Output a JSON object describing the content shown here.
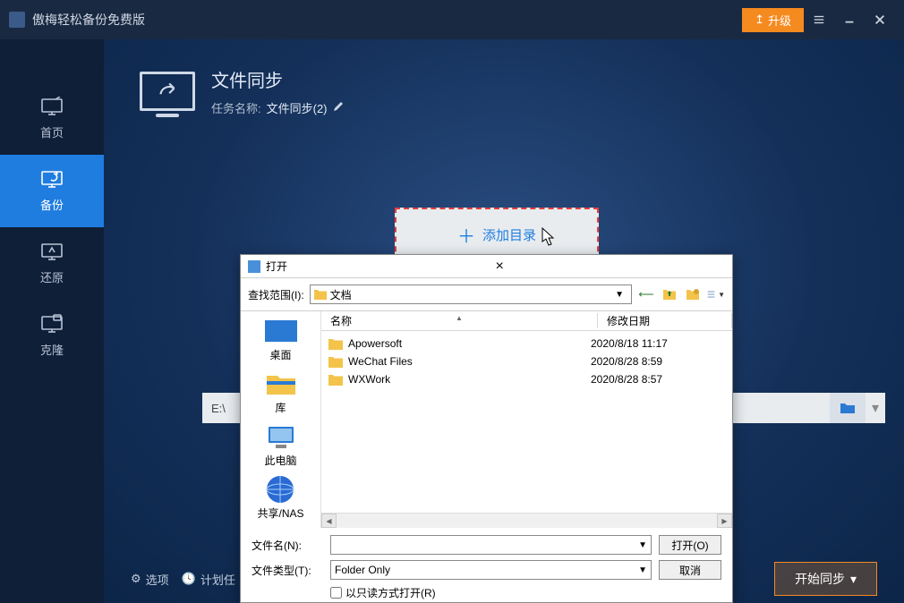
{
  "app": {
    "title": "傲梅轻松备份免费版",
    "upgrade": "升级"
  },
  "sidebar": {
    "items": [
      {
        "label": "首页"
      },
      {
        "label": "备份"
      },
      {
        "label": "还原"
      },
      {
        "label": "克隆"
      }
    ]
  },
  "header": {
    "title": "文件同步",
    "task_label": "任务名称:",
    "task_name": "文件同步(2)"
  },
  "add_dir": {
    "label": "添加目录"
  },
  "dest": {
    "value": "E:\\"
  },
  "bottom": {
    "options": "选项",
    "schedule": "计划任",
    "start": "开始同步"
  },
  "dialog": {
    "title": "打开",
    "path_label": "查找范围(I):",
    "path_value": "文档",
    "columns": {
      "name": "名称",
      "date": "修改日期"
    },
    "places": [
      "桌面",
      "库",
      "此电脑",
      "共享/NAS"
    ],
    "files": [
      {
        "name": "Apowersoft",
        "date": "2020/8/18 11:17"
      },
      {
        "name": "WeChat Files",
        "date": "2020/8/28 8:59"
      },
      {
        "name": "WXWork",
        "date": "2020/8/28 8:57"
      }
    ],
    "filename_label": "文件名(N):",
    "filename_value": "",
    "filetype_label": "文件类型(T):",
    "filetype_value": "Folder Only",
    "open_btn": "打开(O)",
    "cancel_btn": "取消",
    "readonly_label": "以只读方式打开(R)"
  }
}
